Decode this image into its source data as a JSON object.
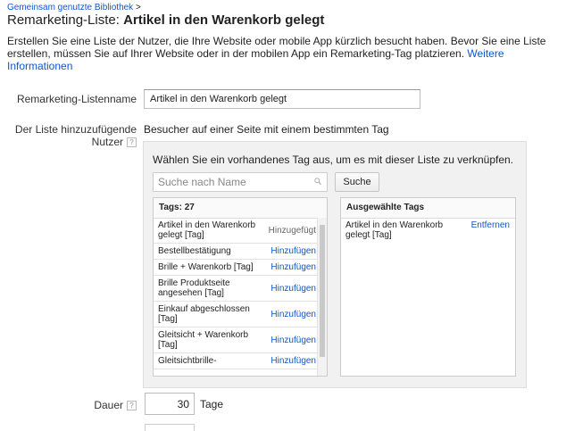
{
  "breadcrumb": {
    "link": "Gemeinsam genutzte Bibliothek",
    "separator": ">"
  },
  "title": {
    "prefix": "Remarketing-Liste:",
    "name": "Artikel in den Warenkorb gelegt"
  },
  "intro": {
    "text": "Erstellen Sie eine Liste der Nutzer, die Ihre Website oder mobile App kürzlich besucht haben. Bevor Sie eine Liste erstellen, müssen Sie auf Ihrer Website oder in der mobilen App ein Remarketing-Tag platzieren.",
    "link": "Weitere Informationen"
  },
  "form": {
    "name_label": "Remarketing-Listenname",
    "name_value": "Artikel in den Warenkorb gelegt",
    "users_label": "Der Liste hinzuzufügende Nutzer",
    "users_value": "Besucher auf einer Seite mit einem bestimmten Tag",
    "help_glyph": "?",
    "duration_label": "Dauer",
    "duration_value": "30",
    "duration_unit": "Tage"
  },
  "tag_picker": {
    "instruction": "Wählen Sie ein vorhandenes Tag aus, um es mit dieser Liste zu verknüpfen.",
    "search_placeholder": "Suche nach Name",
    "search_button": "Suche",
    "tags_header": "Tags: 27",
    "tags": [
      {
        "name": "Artikel in den Warenkorb gelegt [Tag]",
        "action": "Hinzugefügt",
        "added": true
      },
      {
        "name": "Bestellbestätigung",
        "action": "Hinzufügen",
        "added": false
      },
      {
        "name": "Brille + Warenkorb [Tag]",
        "action": "Hinzufügen",
        "added": false
      },
      {
        "name": "Brille Produktseite angesehen [Tag]",
        "action": "Hinzufügen",
        "added": false
      },
      {
        "name": "Einkauf abgeschlossen [Tag]",
        "action": "Hinzufügen",
        "added": false
      },
      {
        "name": "Gleitsicht + Warenkorb [Tag]",
        "action": "Hinzufügen",
        "added": false
      },
      {
        "name": "Gleitsichtbrille-",
        "action": "Hinzufügen",
        "added": false
      }
    ],
    "selected_header": "Ausgewählte Tags",
    "selected": [
      {
        "name": "Artikel in den Warenkorb gelegt [Tag]",
        "action": "Entfernen"
      }
    ]
  },
  "colors": {
    "link": "#1155cc",
    "panel_bg": "#f1f1f1"
  },
  "icons": {
    "search": "magnifier-icon",
    "help": "question-mark-icon"
  }
}
